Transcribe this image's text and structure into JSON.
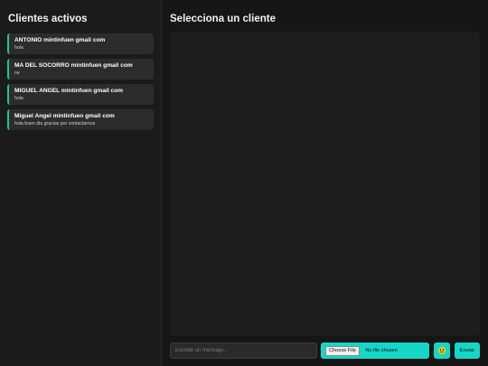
{
  "sidebar": {
    "title": "Clientes activos",
    "clients": [
      {
        "name": "ANTONIO mintinfuen gmail com",
        "last_message": "hola"
      },
      {
        "name": "MA DEL SOCORRO mintinfuen gmail com",
        "last_message": "rw"
      },
      {
        "name": "MIGUEL ANGEL mintinfuen gmail com",
        "last_message": "hola"
      },
      {
        "name": "Miguel Angel mintinfuen gmail com",
        "last_message": "hola buen dia gracias por contactarnos"
      }
    ]
  },
  "main": {
    "title": "Selecciona un cliente"
  },
  "composer": {
    "placeholder": "Escribe un mensaje...",
    "choose_file_label": "Choose File",
    "no_file_text": "No file chosen",
    "emoji_icon": "emoji-icon",
    "send_label": "Enviar"
  },
  "colors": {
    "accent": "#16d6c6",
    "active_border": "#1bc98e",
    "background": "#161616"
  }
}
